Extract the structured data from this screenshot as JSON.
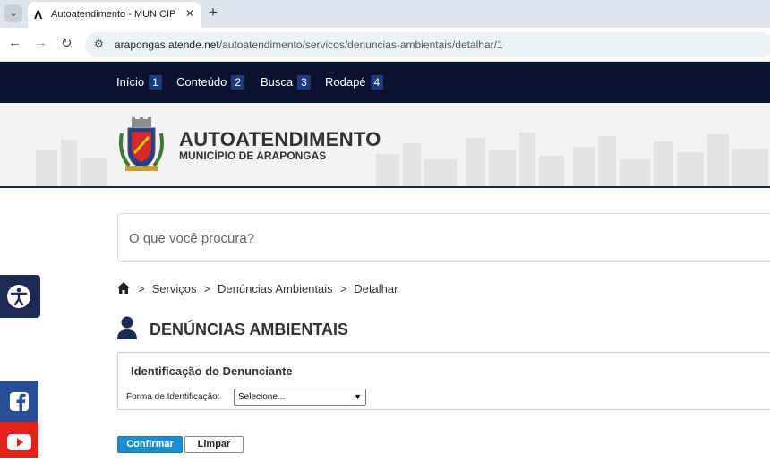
{
  "browser": {
    "tab_title": "Autoatendimento - MUNICÍPIO",
    "tab_close": "✕",
    "new_tab": "+",
    "url_host": "arapongas.atende.net",
    "url_path": "/autoatendimento/servicos/denuncias-ambientais/detalhar/1"
  },
  "skip_links": [
    {
      "label": "Início",
      "key": "1"
    },
    {
      "label": "Conteúdo",
      "key": "2"
    },
    {
      "label": "Busca",
      "key": "3"
    },
    {
      "label": "Rodapé",
      "key": "4"
    }
  ],
  "header": {
    "title": "AUTOATENDIMENTO",
    "subtitle": "MUNICÍPIO DE ARAPONGAS"
  },
  "search": {
    "placeholder": "O que você procura?"
  },
  "breadcrumb": {
    "items": [
      "Serviços",
      "Denúncias Ambientais",
      "Detalhar"
    ]
  },
  "page": {
    "title": "DENÚNCIAS AMBIENTAIS"
  },
  "form": {
    "section_title": "Identificação do Denunciante",
    "field_label": "Forma de Identificação:",
    "select_value": "Selecione..."
  },
  "buttons": {
    "confirm": "Confirmar",
    "clear": "Limpar"
  },
  "colors": {
    "navy": "#0b1330",
    "accent_blue": "#1a8fcf",
    "facebook": "#2a4f96",
    "youtube": "#e62117"
  }
}
